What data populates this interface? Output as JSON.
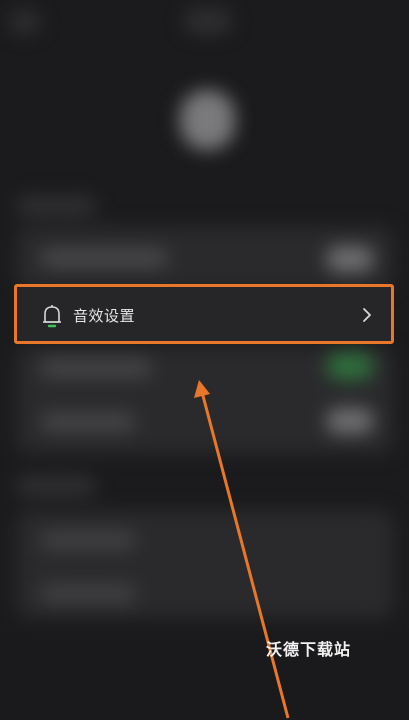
{
  "settings_row": {
    "label": "音效设置",
    "icon": "bell-icon"
  },
  "watermark": "沃德下载站",
  "colors": {
    "highlight": "#e9772a",
    "background": "#1b1b1d",
    "toggle_on": "#2f6e3d"
  }
}
